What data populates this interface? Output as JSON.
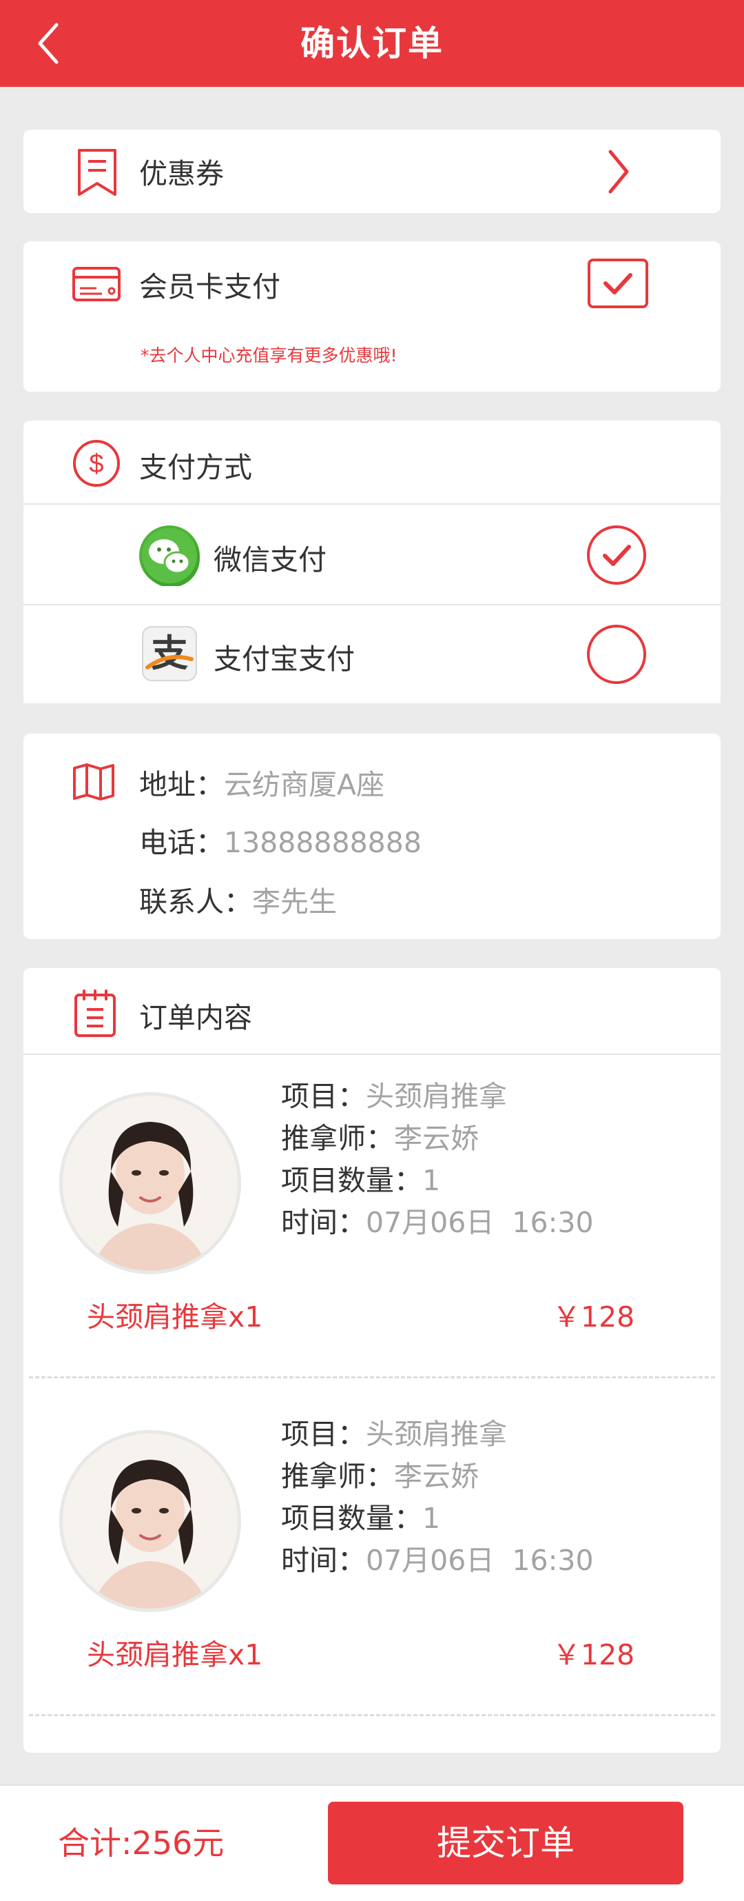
{
  "header": {
    "title": "确认订单"
  },
  "coupon": {
    "label": "优惠券"
  },
  "member_card": {
    "label": "会员卡支付",
    "note": "*去个人中心充值享有更多优惠哦!",
    "checked": true
  },
  "payment": {
    "title": "支付方式",
    "methods": [
      {
        "label": "微信支付",
        "selected": true
      },
      {
        "label": "支付宝支付",
        "selected": false
      }
    ]
  },
  "address": {
    "rows": [
      {
        "key": "地址：",
        "value": "云纺商厦A座"
      },
      {
        "key": "电话：",
        "value": "13888888888"
      },
      {
        "key": "联系人：",
        "value": "李先生"
      }
    ]
  },
  "order": {
    "title": "订单内容",
    "items": [
      {
        "project_key": "项目：",
        "project": "头颈肩推拿",
        "therapist_key": "推拿师：",
        "therapist": "李云娇",
        "qty_key": "项目数量：",
        "qty": "1",
        "time_key": "时间：",
        "time": "07月06日  16:30",
        "summary": "头颈肩推拿x1",
        "price": "￥128"
      },
      {
        "project_key": "项目：",
        "project": "头颈肩推拿",
        "therapist_key": "推拿师：",
        "therapist": "李云娇",
        "qty_key": "项目数量：",
        "qty": "1",
        "time_key": "时间：",
        "time": "07月06日  16:30",
        "summary": "头颈肩推拿x1",
        "price": "￥128"
      }
    ]
  },
  "footer": {
    "total": "合计:256元",
    "submit": "提交订单"
  },
  "colors": {
    "accent": "#e8383d",
    "background": "#ebebeb",
    "muted_text": "#a3a3a3"
  }
}
